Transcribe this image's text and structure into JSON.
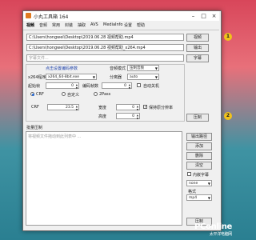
{
  "window": {
    "title": "小丸工具箱 164"
  },
  "tabs": [
    "视频",
    "音频",
    "常用",
    "封装",
    "抽取",
    "AVS",
    "MediaInfo",
    "设置",
    "帮助"
  ],
  "file": {
    "input_path": "C:\\Users\\hongwei\\Desktop\\2019.06.28 视频帮助.mp4",
    "output_path": "C:\\Users\\hongwei\\Desktop\\2019.06.28 视频帮助_x264.mp4",
    "subtitle_placeholder": "字幕文件...",
    "btn_browse": "视频",
    "btn_output": "输出",
    "btn_subtitle": "字幕"
  },
  "settings": {
    "section_link": "点击设置编码参数",
    "encoder_label": "x264程序",
    "encoder_value": "x264_64-8bit.exe",
    "audio_mode_label": "音频模式",
    "audio_mode_value": "压制音频",
    "resolution_label": "分离器",
    "resolution_value": "auto",
    "start_frame_label": "起始帧",
    "start_frame_value": "0",
    "frame_count_label": "编码帧数",
    "frame_count_value": "0",
    "auto_shutdown_label": "自动关机",
    "mode_crf": "CRF",
    "mode_custom": "自定义",
    "mode_2pass": "2Pass",
    "crf_label": "CRF",
    "crf_value": "23.5",
    "width_label": "宽度",
    "width_value": "0",
    "height_label": "高度",
    "height_value": "0",
    "keep_res_label": "保持原分辨率",
    "encode_button": "压制"
  },
  "batch": {
    "title": "批量压制",
    "placeholder": "将视频文件拖动到此列表中 ...",
    "btn_output_path": "输出路径",
    "btn_add": "添加",
    "btn_delete": "删除",
    "btn_clear": "清空",
    "embedded_sub_label": "内嵌字幕",
    "sub_mode_value": "none",
    "format_label": "格式",
    "format_value": "mp4",
    "encode_button": "压制"
  },
  "annotations": {
    "badge1": "1",
    "badge2": "2"
  },
  "watermark": {
    "brand": "PConline",
    "sub": "太平洋电脑网"
  },
  "colors": {
    "badge": "#f1c21b",
    "link": "#1a3fa8"
  }
}
